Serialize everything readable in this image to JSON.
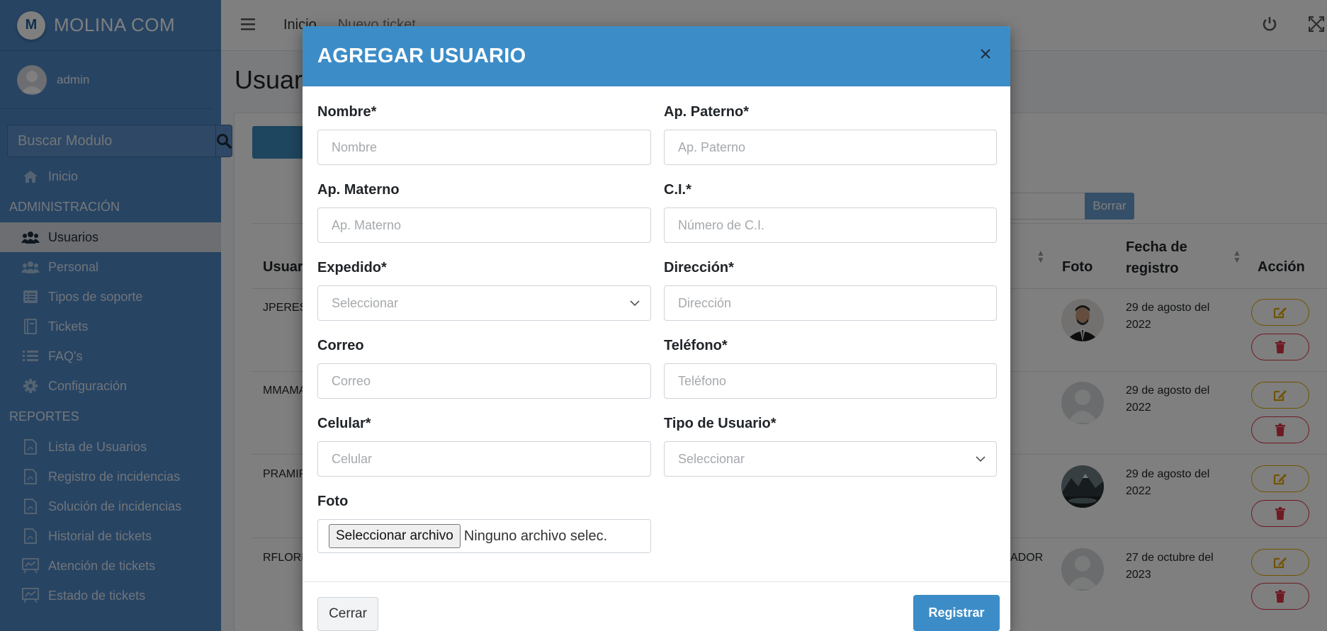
{
  "sidebar": {
    "brand": "MOLINA COM",
    "logo_letter": "M",
    "user": "admin",
    "search_placeholder": "Buscar Modulo",
    "items": [
      {
        "label": "Inicio",
        "icon": "home-icon"
      },
      {
        "header": "ADMINISTRACIÓN"
      },
      {
        "label": "Usuarios",
        "icon": "users-icon",
        "active": true
      },
      {
        "label": "Personal",
        "icon": "user-group-icon"
      },
      {
        "label": "Tipos de soporte",
        "icon": "list-alt-icon"
      },
      {
        "label": "Tickets",
        "icon": "book-icon"
      },
      {
        "label": "FAQ's",
        "icon": "list-icon"
      },
      {
        "label": "Configuración",
        "icon": "gear-icon"
      },
      {
        "header": "REPORTES"
      },
      {
        "label": "Lista de Usuarios",
        "icon": "pdf-icon"
      },
      {
        "label": "Registro de incidencias",
        "icon": "pdf-icon"
      },
      {
        "label": "Solución de incidencias",
        "icon": "pdf-icon"
      },
      {
        "label": "Historial de tickets",
        "icon": "pdf-icon"
      },
      {
        "label": "Atención de tickets",
        "icon": "chalkboard-icon"
      },
      {
        "label": "Estado de tickets",
        "icon": "chalkboard-icon"
      }
    ]
  },
  "topbar": {
    "inicio": "Inicio",
    "nuevo_ticket": "Nuevo ticket"
  },
  "page": {
    "title": "Usuarios",
    "borrar": "Borrar",
    "columns": {
      "usuario": "Usuario",
      "foto": "Foto",
      "fecha": "Fecha de registro",
      "accion": "Acción"
    },
    "rows": [
      {
        "usuario": "JPERES",
        "fecha": "29 de agosto del 2022",
        "photo": "man-suit"
      },
      {
        "usuario": "MMAMANI",
        "fecha": "29 de agosto del 2022",
        "photo": "placeholder"
      },
      {
        "usuario": "PRAMIREZ",
        "fecha": "29 de agosto del 2022",
        "photo": "landscape"
      },
      {
        "usuario": "RFLORES",
        "tipo": "ADOR",
        "fecha": "27 de octubre del 2023",
        "photo": "placeholder"
      }
    ]
  },
  "modal": {
    "title": "AGREGAR USUARIO",
    "close": "×",
    "fields": {
      "nombre": {
        "label": "Nombre*",
        "placeholder": "Nombre"
      },
      "paterno": {
        "label": "Ap. Paterno*",
        "placeholder": "Ap. Paterno"
      },
      "materno": {
        "label": "Ap. Materno",
        "placeholder": "Ap. Materno"
      },
      "ci": {
        "label": "C.I.*",
        "placeholder": "Número de C.I."
      },
      "expedido": {
        "label": "Expedido*",
        "value": "Seleccionar"
      },
      "direccion": {
        "label": "Dirección*",
        "placeholder": "Dirección"
      },
      "correo": {
        "label": "Correo",
        "placeholder": "Correo"
      },
      "telefono": {
        "label": "Teléfono*",
        "placeholder": "Teléfono"
      },
      "celular": {
        "label": "Celular*",
        "placeholder": "Celular"
      },
      "tipo": {
        "label": "Tipo de Usuario*",
        "value": "Seleccionar"
      },
      "foto": {
        "label": "Foto",
        "button": "Seleccionar archivo",
        "file": "Ninguno archivo selec."
      }
    },
    "cerrar": "Cerrar",
    "registrar": "Registrar"
  },
  "colors": {
    "sidebar": "#4e88c6",
    "modal_header": "#3c8dc7",
    "primary": "#3c8dc7",
    "warning": "#e0a800",
    "danger": "#dc3545"
  }
}
